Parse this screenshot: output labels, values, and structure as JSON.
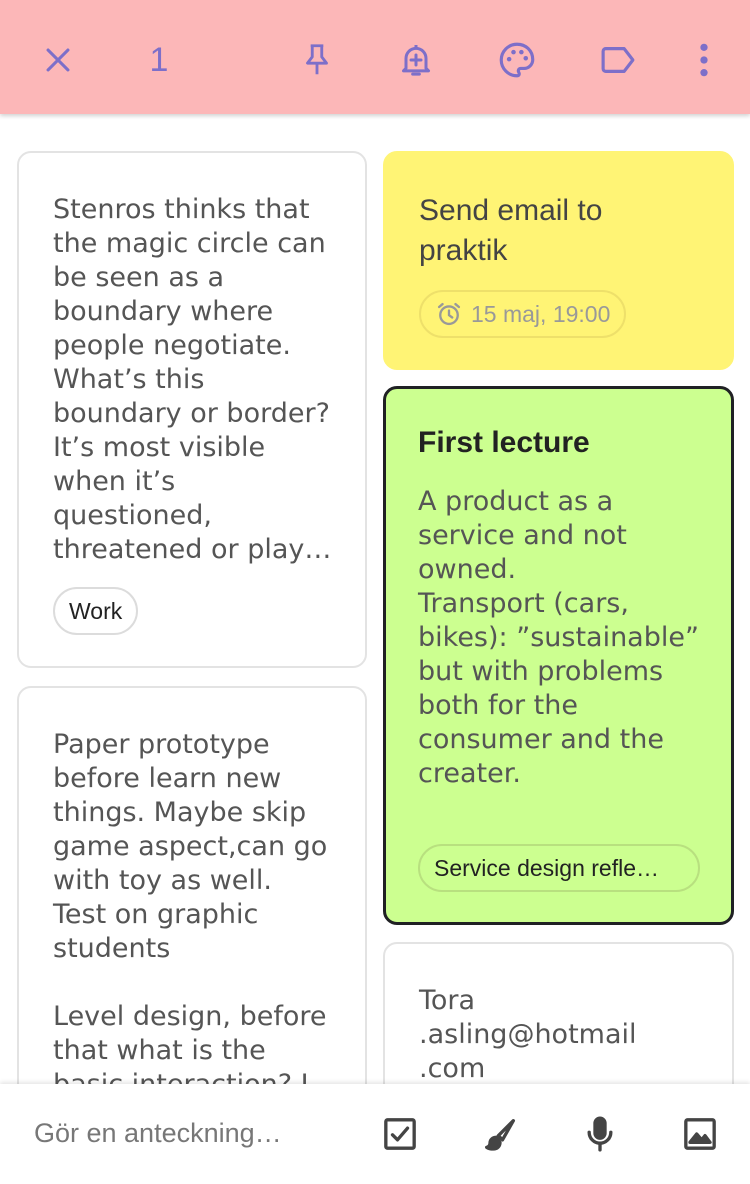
{
  "toolbar": {
    "selected_count": "1",
    "icons": [
      "close-icon",
      "pin-icon",
      "reminder-icon",
      "palette-icon",
      "label-icon",
      "more-icon"
    ],
    "background": "#fcb7b8",
    "icon_color": "#7d6fc9"
  },
  "notes": {
    "left": [
      {
        "body": "Stenros thinks that\nthe magic circle can\nbe seen as a\nboundary where\npeople negotiate.\nWhat’s this\nboundary or border?\nIt’s most visible\nwhen it’s\nquestioned,\nthreatened or play…",
        "label": "Work",
        "color": "#ffffff"
      },
      {
        "body": "Paper prototype\nbefore learn new\nthings. Maybe skip\ngame aspect,can go\nwith toy as well.\nTest on graphic\nstudents\n\nLevel design, before\nthat what is the\nbasic interaction? I",
        "color": "#ffffff"
      }
    ],
    "right": [
      {
        "title": "Send email to\npraktik",
        "reminder": "15 maj, 19:00",
        "color": "#fff475"
      },
      {
        "title": "First lecture",
        "body": "A product as a\nservice and not\nowned.\nTransport (cars,\nbikes): ”sustainable”\nbut with problems\nboth for the\nconsumer and the\ncreater.",
        "label": "Service design refle…",
        "color": "#ccff90",
        "selected": true
      },
      {
        "body": "Tora\n.asling@hotmail\n.com",
        "color": "#ffffff"
      }
    ]
  },
  "bottom": {
    "placeholder": "Gör en anteckning…",
    "icons": [
      "checkbox-icon",
      "brush-icon",
      "mic-icon",
      "image-icon"
    ]
  }
}
